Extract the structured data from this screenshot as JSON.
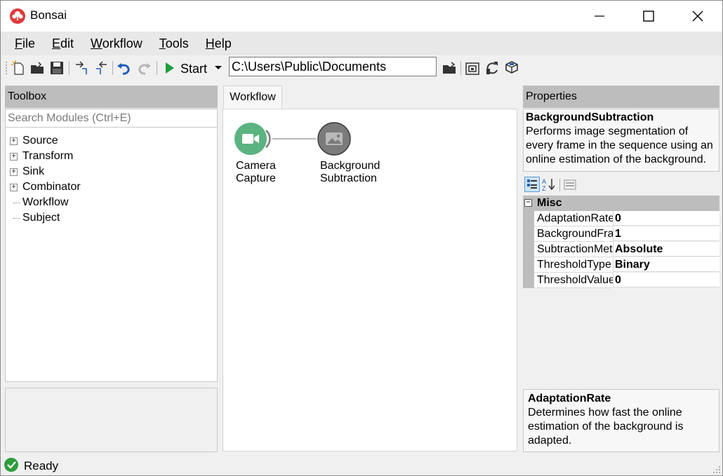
{
  "window": {
    "title": "Bonsai"
  },
  "menu": [
    {
      "u": "F",
      "rest": "ile"
    },
    {
      "u": "E",
      "rest": "dit"
    },
    {
      "u": "W",
      "rest": "orkflow"
    },
    {
      "u": "T",
      "rest": "ools"
    },
    {
      "u": "H",
      "rest": "elp"
    }
  ],
  "toolbar": {
    "start_label": "Start",
    "path_value": "C:\\Users\\Public\\Documents"
  },
  "toolbox": {
    "header": "Toolbox",
    "search_placeholder": "Search Modules (Ctrl+E)",
    "items": [
      {
        "label": "Source",
        "expandable": true
      },
      {
        "label": "Transform",
        "expandable": true
      },
      {
        "label": "Sink",
        "expandable": true
      },
      {
        "label": "Combinator",
        "expandable": true
      },
      {
        "label": "Workflow",
        "expandable": false
      },
      {
        "label": "Subject",
        "expandable": false
      }
    ]
  },
  "workflow": {
    "tab_label": "Workflow",
    "nodes": [
      {
        "line1": "Camera",
        "line2": "Capture",
        "color": "#5bb381"
      },
      {
        "line1": "Background",
        "line2": "Subtraction",
        "color": "#7b7b7b"
      }
    ]
  },
  "properties": {
    "header": "Properties",
    "selected_name": "BackgroundSubtraction",
    "selected_description": "Performs image segmentation of every frame in the sequence using an online estimation of the background.",
    "category": "Misc",
    "rows": [
      {
        "name": "AdaptationRate",
        "value": "0"
      },
      {
        "name": "BackgroundFrames",
        "value": "1"
      },
      {
        "name": "SubtractionMethod",
        "value": "Absolute"
      },
      {
        "name": "ThresholdType",
        "value": "Binary"
      },
      {
        "name": "ThresholdValue",
        "value": "0"
      }
    ],
    "help_name": "AdaptationRate",
    "help_description": "Determines how fast the online estimation of the background is adapted."
  },
  "status": {
    "text": "Ready"
  },
  "colors": {
    "panel_header": "#bdbdbd",
    "start_green": "#1e9e3e",
    "undo_blue": "#1f5fb8",
    "status_green": "#2e9d3c"
  }
}
